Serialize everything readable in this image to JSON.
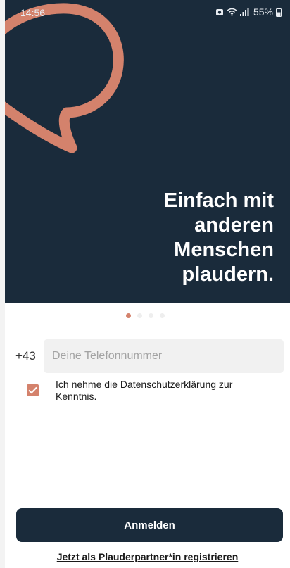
{
  "status_bar": {
    "time": "14:56",
    "battery": "55%",
    "icons": [
      "data-saver-icon",
      "wifi-icon",
      "signal-icon",
      "battery-icon"
    ]
  },
  "hero": {
    "logo_icon": "speech-bubble-logo-icon",
    "headline_lines": [
      "Einfach mit",
      "anderen",
      "Menschen",
      "plaudern."
    ],
    "colors": {
      "background": "#1a2b3b",
      "logo": "#d4826c"
    }
  },
  "pager": {
    "count": 4,
    "active_index": 0
  },
  "form": {
    "country_code": "+43",
    "phone_placeholder": "Deine Telefonnummer",
    "phone_value": "",
    "consent_checked": true,
    "consent_prefix": "Ich nehme die",
    "consent_link": "Datenschutzerklärung",
    "consent_suffix": "zur Kenntnis."
  },
  "actions": {
    "login_label": "Anmelden",
    "register_label": "Jetzt als Plauderpartner*in registrieren"
  },
  "colors": {
    "accent": "#d4826c",
    "primary": "#1a2b3b"
  }
}
